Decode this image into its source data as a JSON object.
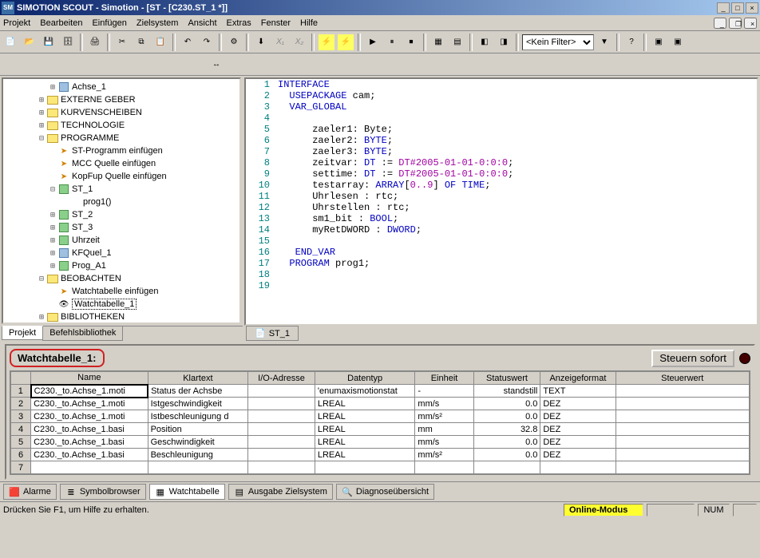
{
  "title": "SIMOTION SCOUT - Simotion - [ST - [C230.ST_1 *]]",
  "menu": [
    "Projekt",
    "Bearbeiten",
    "Einfügen",
    "Zielsystem",
    "Ansicht",
    "Extras",
    "Fenster",
    "Hilfe"
  ],
  "filter_value": "<Kein Filter>",
  "tree": {
    "items": [
      {
        "indent": 4,
        "exp": "⊞",
        "icon": "chip",
        "label": "Achse_1"
      },
      {
        "indent": 3,
        "exp": "⊞",
        "icon": "folder",
        "label": "EXTERNE GEBER"
      },
      {
        "indent": 3,
        "exp": "⊞",
        "icon": "folder",
        "label": "KURVENSCHEIBEN"
      },
      {
        "indent": 3,
        "exp": "⊞",
        "icon": "folder",
        "label": "TECHNOLOGIE"
      },
      {
        "indent": 3,
        "exp": "⊟",
        "icon": "folder-open",
        "label": "PROGRAMME"
      },
      {
        "indent": 4,
        "exp": "",
        "icon": "wiz",
        "label": "ST-Programm einfügen"
      },
      {
        "indent": 4,
        "exp": "",
        "icon": "wiz",
        "label": "MCC Quelle einfügen"
      },
      {
        "indent": 4,
        "exp": "",
        "icon": "wiz",
        "label": "KopFup Quelle einfügen"
      },
      {
        "indent": 4,
        "exp": "⊟",
        "icon": "block",
        "label": "ST_1"
      },
      {
        "indent": 5,
        "exp": "",
        "icon": "",
        "label": "prog1()"
      },
      {
        "indent": 4,
        "exp": "⊞",
        "icon": "block",
        "label": "ST_2"
      },
      {
        "indent": 4,
        "exp": "⊞",
        "icon": "block",
        "label": "ST_3"
      },
      {
        "indent": 4,
        "exp": "⊞",
        "icon": "block",
        "label": "Uhrzeit"
      },
      {
        "indent": 4,
        "exp": "⊞",
        "icon": "chip",
        "label": "KFQuel_1"
      },
      {
        "indent": 4,
        "exp": "⊞",
        "icon": "block",
        "label": "Prog_A1"
      },
      {
        "indent": 3,
        "exp": "⊟",
        "icon": "folder-open",
        "label": "BEOBACHTEN"
      },
      {
        "indent": 4,
        "exp": "",
        "icon": "wiz",
        "label": "Watchtabelle einfügen"
      },
      {
        "indent": 4,
        "exp": "",
        "icon": "watch",
        "label": "Watchtabelle_1",
        "selected": true
      },
      {
        "indent": 3,
        "exp": "⊞",
        "icon": "folder",
        "label": "BIBLIOTHEKEN"
      }
    ],
    "tabs": {
      "projekt": "Projekt",
      "befehle": "Befehlsbibliothek"
    }
  },
  "code": {
    "tab_label": "ST_1",
    "lines": [
      {
        "n": 1,
        "html": "<span class='kw'>INTERFACE</span>"
      },
      {
        "n": 2,
        "html": "  <span class='kw'>USEPACKAGE</span> cam;"
      },
      {
        "n": 3,
        "html": "  <span class='kw'>VAR_GLOBAL</span>"
      },
      {
        "n": 4,
        "html": ""
      },
      {
        "n": 5,
        "html": "      zaeler1: Byte;"
      },
      {
        "n": 6,
        "html": "      zaeler2: <span class='kw'>BYTE</span>;"
      },
      {
        "n": 7,
        "html": "      zaeler3: <span class='kw'>BYTE</span>;"
      },
      {
        "n": 8,
        "html": "      zeitvar: <span class='kw'>DT</span> := <span class='str'>DT#2005-01-01-0:0:0</span>;"
      },
      {
        "n": 9,
        "html": "      settime: <span class='kw'>DT</span> := <span class='str'>DT#2005-01-01-0:0:0</span>;"
      },
      {
        "n": 10,
        "html": "      testarray: <span class='kw'>ARRAY</span>[<span class='str'>0..9</span>] <span class='kw'>OF TIME</span>;"
      },
      {
        "n": 11,
        "html": "      Uhrlesen : rtc;"
      },
      {
        "n": 12,
        "html": "      Uhrstellen : rtc;"
      },
      {
        "n": 13,
        "html": "      sm1_bit : <span class='kw'>BOOL</span>;"
      },
      {
        "n": 14,
        "html": "      myRetDWORD : <span class='kw'>DWORD</span>;"
      },
      {
        "n": 15,
        "html": ""
      },
      {
        "n": 16,
        "html": "   <span class='kw'>END_VAR</span>"
      },
      {
        "n": 17,
        "html": "  <span class='kw'>PROGRAM</span> prog1;"
      },
      {
        "n": 18,
        "html": ""
      },
      {
        "n": 19,
        "html": ""
      }
    ]
  },
  "watch": {
    "title": "Watchtabelle_1:",
    "steuern_btn": "Steuern sofort",
    "headers": [
      "",
      "Name",
      "Klartext",
      "I/O-Adresse",
      "Datentyp",
      "Einheit",
      "Statuswert",
      "Anzeigeformat",
      "Steuerwert"
    ],
    "rows": [
      {
        "n": "1",
        "name": "C230._to.Achse_1.moti",
        "klar": "Status der Achsbe",
        "io": "",
        "typ": "'enumaxismotionstat",
        "ein": "-",
        "stat": "standstill",
        "fmt": "TEXT",
        "steu": ""
      },
      {
        "n": "2",
        "name": "C230._to.Achse_1.moti",
        "klar": "Istgeschwindigkeit",
        "io": "",
        "typ": "LREAL",
        "ein": "mm/s",
        "stat": "0.0",
        "fmt": "DEZ",
        "steu": ""
      },
      {
        "n": "3",
        "name": "C230._to.Achse_1.moti",
        "klar": "Istbeschleunigung d",
        "io": "",
        "typ": "LREAL",
        "ein": "mm/s²",
        "stat": "0.0",
        "fmt": "DEZ",
        "steu": ""
      },
      {
        "n": "4",
        "name": "C230._to.Achse_1.basi",
        "klar": "Position",
        "io": "",
        "typ": "LREAL",
        "ein": "mm",
        "stat": "32.8",
        "fmt": "DEZ",
        "steu": ""
      },
      {
        "n": "5",
        "name": "C230._to.Achse_1.basi",
        "klar": "Geschwindigkeit",
        "io": "",
        "typ": "LREAL",
        "ein": "mm/s",
        "stat": "0.0",
        "fmt": "DEZ",
        "steu": ""
      },
      {
        "n": "6",
        "name": "C230._to.Achse_1.basi",
        "klar": "Beschleunigung",
        "io": "",
        "typ": "LREAL",
        "ein": "mm/s²",
        "stat": "0.0",
        "fmt": "DEZ",
        "steu": ""
      },
      {
        "n": "7",
        "name": "",
        "klar": "",
        "io": "",
        "typ": "",
        "ein": "",
        "stat": "",
        "fmt": "",
        "steu": ""
      }
    ]
  },
  "bottom_tabs": [
    {
      "icon": "🟥",
      "label": "Alarme"
    },
    {
      "icon": "≣",
      "label": "Symbolbrowser"
    },
    {
      "icon": "▦",
      "label": "Watchtabelle",
      "active": true
    },
    {
      "icon": "▤",
      "label": "Ausgabe Zielsystem"
    },
    {
      "icon": "🔍",
      "label": "Diagnoseübersicht"
    }
  ],
  "status": {
    "help": "Drücken Sie F1, um Hilfe zu erhalten.",
    "mode": "Online-Modus",
    "num": "NUM"
  }
}
